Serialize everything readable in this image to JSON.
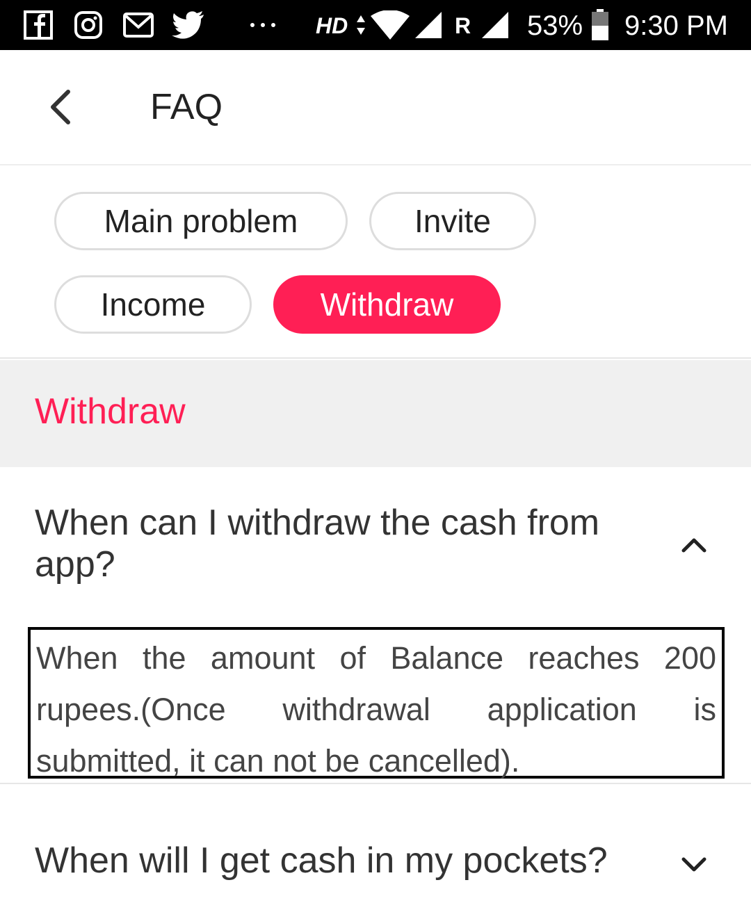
{
  "status_bar": {
    "network": "HD",
    "roaming": "R",
    "battery": "53%",
    "time": "9:30 PM",
    "notification_icons": [
      "facebook-icon",
      "instagram-icon",
      "gmail-icon",
      "twitter-icon",
      "more-dots-icon"
    ]
  },
  "app_bar": {
    "title": "FAQ",
    "back_icon": "chevron-left-icon"
  },
  "categories": [
    {
      "label": "Main problem",
      "active": false
    },
    {
      "label": "Invite",
      "active": false
    },
    {
      "label": "Income",
      "active": false
    },
    {
      "label": "Withdraw",
      "active": true
    }
  ],
  "section": {
    "title": "Withdraw"
  },
  "faq": [
    {
      "question": "When can I withdraw the cash from app?",
      "expanded": true,
      "answer": "When the amount of Balance reaches 200 rupees.(Once withdrawal application is submitted, it can not be cancelled)."
    },
    {
      "question": "When will I get cash in my pockets?",
      "expanded": false
    }
  ],
  "colors": {
    "accent": "#ff1f55",
    "section_background": "#f0f0f0",
    "status_bar": "#000000"
  }
}
